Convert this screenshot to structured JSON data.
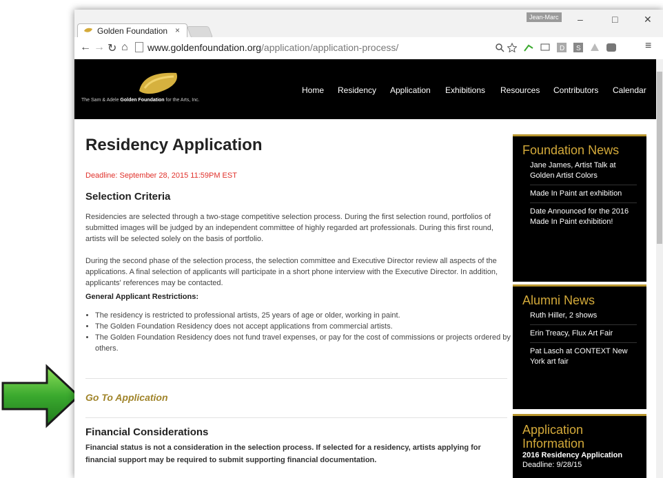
{
  "browser": {
    "tab_title": "Golden Foundation",
    "tab_close": "×",
    "profile_name": "Jean-Marc",
    "url_domain": "www.goldenfoundation.org",
    "url_path": "/application/application-process/",
    "window_controls": [
      "–",
      "□",
      "✕"
    ]
  },
  "site": {
    "logo_text_pre": "The Sam & Adele ",
    "logo_text_bold": "Golden Foundation",
    "logo_text_post": " for the Arts, Inc.",
    "nav": [
      "Home",
      "Residency",
      "Application",
      "Exhibitions",
      "Resources",
      "Contributors",
      "Calendar"
    ]
  },
  "main": {
    "title": "Residency Application",
    "deadline": "Deadline: September 28, 2015 11:59PM EST",
    "selection_heading": "Selection Criteria",
    "para1": "Residencies are selected through a two-stage competitive selection process. During the first selection round, portfolios of submitted images will be judged by an independent committee of highly regarded art professionals. During this first round, artists will be selected solely on the basis of portfolio.",
    "para2": "During the second phase of the selection process, the selection committee and Executive Director review all aspects of the applications. A final selection of applicants will participate in a short phone interview with the Executive Director. In addition, applicants' references may be contacted.",
    "restrictions_heading": "General Applicant Restrictions:",
    "restrictions": [
      "The residency is restricted to professional artists, 25 years of age or older, working in paint.",
      "The Golden Foundation Residency does not accept applications from commercial artists.",
      "The Golden Foundation Residency does not fund travel expenses, or pay for the cost of commissions or projects ordered by others."
    ],
    "go_to_application": "Go To Application",
    "financial_heading": "Financial Considerations",
    "financial_text": "Financial status is not a consideration in the selection process. If selected for a residency, artists applying for financial support may be required to submit supporting financial documentation."
  },
  "sidebar": {
    "foundation_news": {
      "title": "Foundation News",
      "items": [
        "Jane James, Artist Talk at Golden Artist Colors",
        "Made In Paint art exhibition",
        "Date Announced for the 2016 Made In Paint exhibition!"
      ]
    },
    "alumni_news": {
      "title": "Alumni News",
      "items": [
        "Ruth Hiller, 2 shows",
        "Erin Treacy, Flux Art Fair",
        "Pat Lasch at CONTEXT New York art fair"
      ]
    },
    "application_info": {
      "title": "Application Information",
      "line1": "2016 Residency Application",
      "line2": "Deadline: 9/28/15"
    }
  },
  "colors": {
    "accent_gold": "#d4aa3a",
    "link_gold": "#a0842a",
    "deadline_red": "#e0302a",
    "arrow_green": "#3aa92e"
  }
}
